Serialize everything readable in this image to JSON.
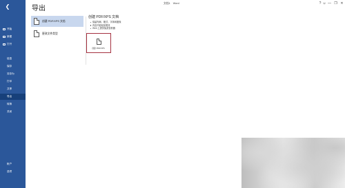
{
  "window": {
    "doc_name": "文档1",
    "app_name": "Word",
    "controls": [
      "?",
      "☺",
      "—",
      "❐",
      "✕"
    ]
  },
  "sidebar": {
    "back_icon": "back-arrow-icon",
    "items": [
      {
        "label": "开始",
        "icon": "home-icon"
      },
      {
        "label": "新建",
        "icon": "new-icon"
      },
      {
        "label": "打开",
        "icon": "open-icon"
      }
    ],
    "items2": [
      {
        "label": "信息"
      },
      {
        "label": "保存"
      },
      {
        "label": "另存为"
      },
      {
        "label": "打印"
      },
      {
        "label": "共享"
      },
      {
        "label": "导出",
        "selected": true
      },
      {
        "label": "转换"
      },
      {
        "label": "关闭"
      }
    ],
    "bottom": [
      {
        "label": "帐户"
      },
      {
        "label": "选项"
      }
    ]
  },
  "page": {
    "title": "导出"
  },
  "options": [
    {
      "label": "创建 PDF/XPS 文档",
      "selected": true
    },
    {
      "label": "更改文件类型",
      "selected": false
    }
  ],
  "detail": {
    "heading": "创建 PDF/XPS 文档",
    "bullets": [
      "保留布局、格式、字体和图像",
      "内容不能轻易更改",
      "Web 上提供免费查看器"
    ],
    "button_label": "创建 PDF/XPS"
  }
}
